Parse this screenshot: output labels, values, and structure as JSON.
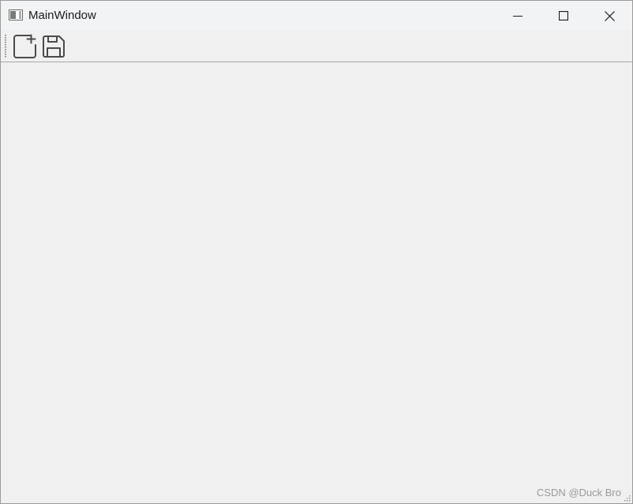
{
  "window": {
    "title": "MainWindow",
    "caption_buttons": [
      "minimize-icon",
      "maximize-icon",
      "close-icon"
    ]
  },
  "toolbar": {
    "actions": [
      {
        "icon": "new-file-icon"
      },
      {
        "icon": "save-icon"
      }
    ]
  },
  "watermark": {
    "text": "CSDN @Duck Bro"
  },
  "colors": {
    "window_bg": "#f0f0f0",
    "titlebar_bg": "#f2f3f5",
    "icon_stroke": "#4a4a4a"
  }
}
